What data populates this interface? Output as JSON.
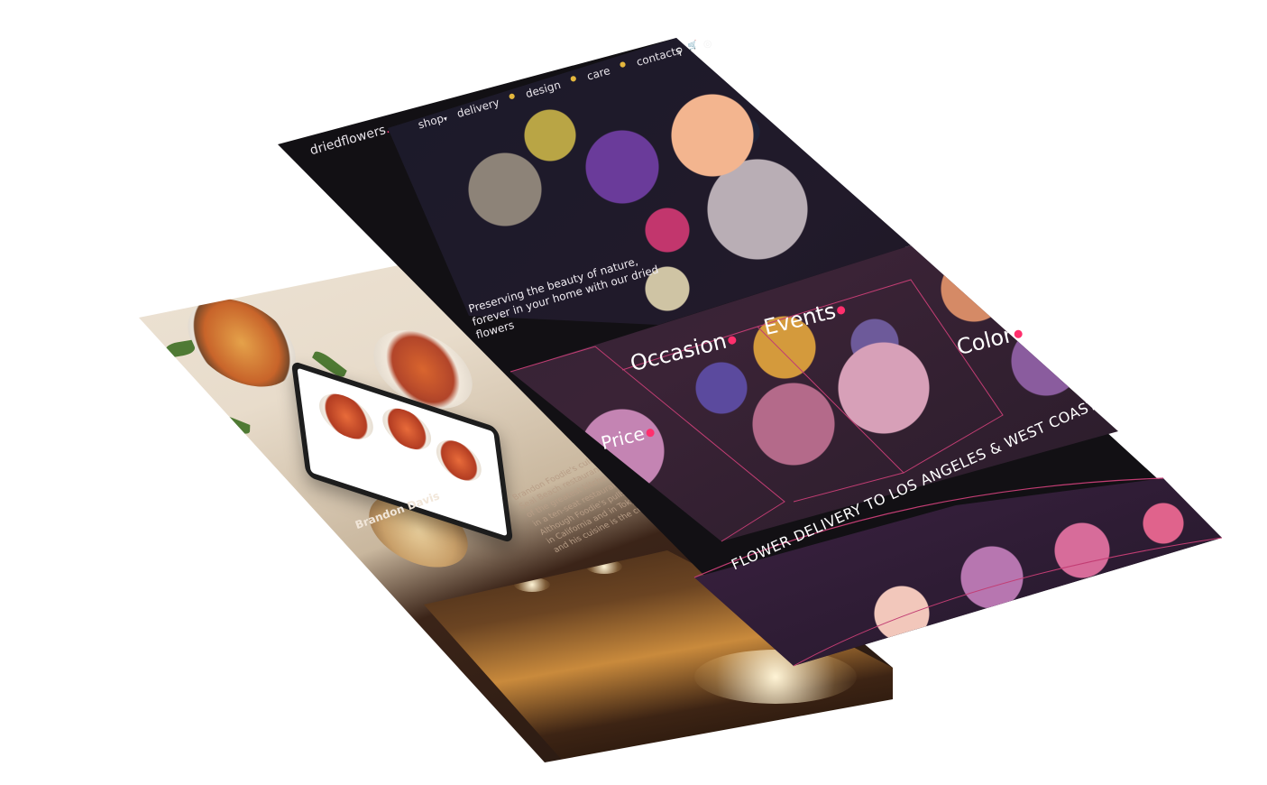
{
  "back_site": {
    "chef_name": "Brandon Davis",
    "bio_lines": [
      "Brandon Foodie's culinary...",
      "Seal Beach restaurant of his...",
      "of the greatest kitchens in...",
      "in a ten-seat restaurant in...",
      "Although Foodie's pulls...",
      "in California and in Tokyo...",
      "and his cuisine is the cuisine of..."
    ]
  },
  "front_site": {
    "logo": "driedflowers",
    "logo_dot": ".",
    "nav": {
      "items": [
        "shop",
        "delivery",
        "design",
        "care",
        "contacts"
      ],
      "shop_caret": "▾",
      "separator": "●"
    },
    "icons": {
      "search": "⚲",
      "cart": "🛒",
      "account": "◎"
    },
    "tagline": "Preserving the beauty of nature, forever in your home with our dried flowers",
    "categories": {
      "occasion": "Occasion",
      "events": "Events",
      "color": "Color",
      "price": "Price"
    },
    "delivery_banner": "FLOWER DELIVERY TO LOS ANGELES & WEST COAST",
    "colors": {
      "accent": "#ff2f6d",
      "background": "#121014",
      "separator": "#e4b73d"
    }
  }
}
